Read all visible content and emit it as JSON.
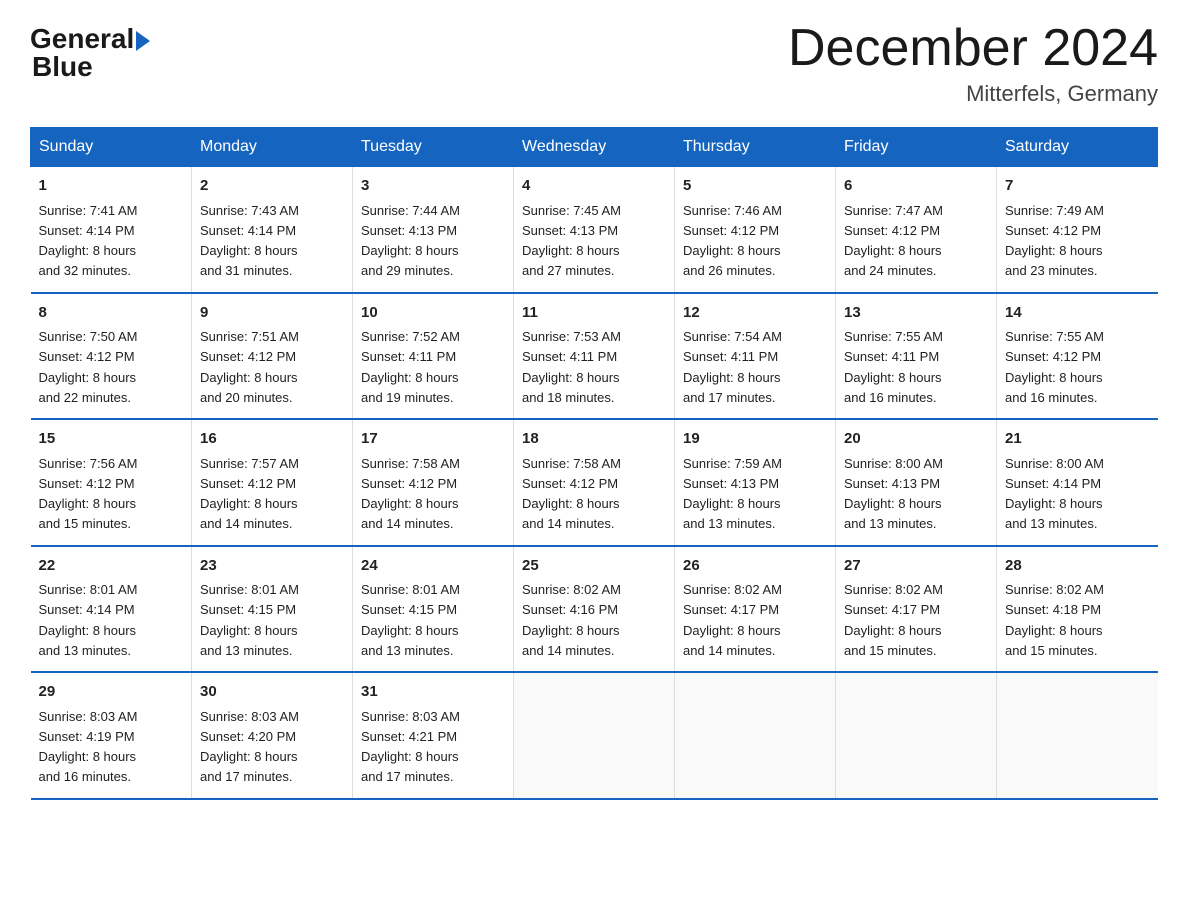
{
  "logo": {
    "part1": "General",
    "part2": "Blue"
  },
  "title": "December 2024",
  "subtitle": "Mitterfels, Germany",
  "weekdays": [
    "Sunday",
    "Monday",
    "Tuesday",
    "Wednesday",
    "Thursday",
    "Friday",
    "Saturday"
  ],
  "weeks": [
    [
      {
        "day": "1",
        "sunrise": "7:41 AM",
        "sunset": "4:14 PM",
        "daylight": "8 hours and 32 minutes."
      },
      {
        "day": "2",
        "sunrise": "7:43 AM",
        "sunset": "4:14 PM",
        "daylight": "8 hours and 31 minutes."
      },
      {
        "day": "3",
        "sunrise": "7:44 AM",
        "sunset": "4:13 PM",
        "daylight": "8 hours and 29 minutes."
      },
      {
        "day": "4",
        "sunrise": "7:45 AM",
        "sunset": "4:13 PM",
        "daylight": "8 hours and 27 minutes."
      },
      {
        "day": "5",
        "sunrise": "7:46 AM",
        "sunset": "4:12 PM",
        "daylight": "8 hours and 26 minutes."
      },
      {
        "day": "6",
        "sunrise": "7:47 AM",
        "sunset": "4:12 PM",
        "daylight": "8 hours and 24 minutes."
      },
      {
        "day": "7",
        "sunrise": "7:49 AM",
        "sunset": "4:12 PM",
        "daylight": "8 hours and 23 minutes."
      }
    ],
    [
      {
        "day": "8",
        "sunrise": "7:50 AM",
        "sunset": "4:12 PM",
        "daylight": "8 hours and 22 minutes."
      },
      {
        "day": "9",
        "sunrise": "7:51 AM",
        "sunset": "4:12 PM",
        "daylight": "8 hours and 20 minutes."
      },
      {
        "day": "10",
        "sunrise": "7:52 AM",
        "sunset": "4:11 PM",
        "daylight": "8 hours and 19 minutes."
      },
      {
        "day": "11",
        "sunrise": "7:53 AM",
        "sunset": "4:11 PM",
        "daylight": "8 hours and 18 minutes."
      },
      {
        "day": "12",
        "sunrise": "7:54 AM",
        "sunset": "4:11 PM",
        "daylight": "8 hours and 17 minutes."
      },
      {
        "day": "13",
        "sunrise": "7:55 AM",
        "sunset": "4:11 PM",
        "daylight": "8 hours and 16 minutes."
      },
      {
        "day": "14",
        "sunrise": "7:55 AM",
        "sunset": "4:12 PM",
        "daylight": "8 hours and 16 minutes."
      }
    ],
    [
      {
        "day": "15",
        "sunrise": "7:56 AM",
        "sunset": "4:12 PM",
        "daylight": "8 hours and 15 minutes."
      },
      {
        "day": "16",
        "sunrise": "7:57 AM",
        "sunset": "4:12 PM",
        "daylight": "8 hours and 14 minutes."
      },
      {
        "day": "17",
        "sunrise": "7:58 AM",
        "sunset": "4:12 PM",
        "daylight": "8 hours and 14 minutes."
      },
      {
        "day": "18",
        "sunrise": "7:58 AM",
        "sunset": "4:12 PM",
        "daylight": "8 hours and 14 minutes."
      },
      {
        "day": "19",
        "sunrise": "7:59 AM",
        "sunset": "4:13 PM",
        "daylight": "8 hours and 13 minutes."
      },
      {
        "day": "20",
        "sunrise": "8:00 AM",
        "sunset": "4:13 PM",
        "daylight": "8 hours and 13 minutes."
      },
      {
        "day": "21",
        "sunrise": "8:00 AM",
        "sunset": "4:14 PM",
        "daylight": "8 hours and 13 minutes."
      }
    ],
    [
      {
        "day": "22",
        "sunrise": "8:01 AM",
        "sunset": "4:14 PM",
        "daylight": "8 hours and 13 minutes."
      },
      {
        "day": "23",
        "sunrise": "8:01 AM",
        "sunset": "4:15 PM",
        "daylight": "8 hours and 13 minutes."
      },
      {
        "day": "24",
        "sunrise": "8:01 AM",
        "sunset": "4:15 PM",
        "daylight": "8 hours and 13 minutes."
      },
      {
        "day": "25",
        "sunrise": "8:02 AM",
        "sunset": "4:16 PM",
        "daylight": "8 hours and 14 minutes."
      },
      {
        "day": "26",
        "sunrise": "8:02 AM",
        "sunset": "4:17 PM",
        "daylight": "8 hours and 14 minutes."
      },
      {
        "day": "27",
        "sunrise": "8:02 AM",
        "sunset": "4:17 PM",
        "daylight": "8 hours and 15 minutes."
      },
      {
        "day": "28",
        "sunrise": "8:02 AM",
        "sunset": "4:18 PM",
        "daylight": "8 hours and 15 minutes."
      }
    ],
    [
      {
        "day": "29",
        "sunrise": "8:03 AM",
        "sunset": "4:19 PM",
        "daylight": "8 hours and 16 minutes."
      },
      {
        "day": "30",
        "sunrise": "8:03 AM",
        "sunset": "4:20 PM",
        "daylight": "8 hours and 17 minutes."
      },
      {
        "day": "31",
        "sunrise": "8:03 AM",
        "sunset": "4:21 PM",
        "daylight": "8 hours and 17 minutes."
      },
      null,
      null,
      null,
      null
    ]
  ]
}
